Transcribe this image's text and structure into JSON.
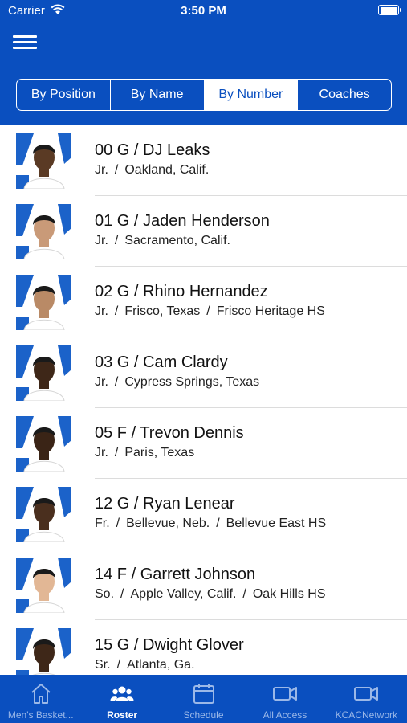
{
  "status_bar": {
    "carrier": "Carrier",
    "time": "3:50 PM"
  },
  "segments": [
    {
      "label": "By Position",
      "active": false
    },
    {
      "label": "By Name",
      "active": false
    },
    {
      "label": "By Number",
      "active": true
    },
    {
      "label": "Coaches",
      "active": false
    }
  ],
  "roster": [
    {
      "title": "00 G / DJ Leaks",
      "details": [
        "Jr.",
        "Oakland, Calif."
      ]
    },
    {
      "title": "01 G / Jaden Henderson",
      "details": [
        "Jr.",
        "Sacramento, Calif."
      ]
    },
    {
      "title": "02 G / Rhino Hernandez",
      "details": [
        "Jr.",
        "Frisco, Texas",
        "Frisco Heritage HS"
      ]
    },
    {
      "title": "03 G / Cam Clardy",
      "details": [
        "Jr.",
        "Cypress Springs, Texas"
      ]
    },
    {
      "title": "05 F / Trevon Dennis",
      "details": [
        "Jr.",
        "Paris, Texas"
      ]
    },
    {
      "title": "12 G / Ryan Lenear",
      "details": [
        "Fr.",
        "Bellevue, Neb.",
        "Bellevue East HS"
      ]
    },
    {
      "title": "14 F / Garrett Johnson",
      "details": [
        "So.",
        "Apple Valley, Calif.",
        "Oak Hills HS"
      ]
    },
    {
      "title": "15 G / Dwight Glover",
      "details": [
        "Sr.",
        "Atlanta, Ga."
      ]
    }
  ],
  "tabs": [
    {
      "label": "Men's Basket...",
      "icon": "home-icon",
      "active": false
    },
    {
      "label": "Roster",
      "icon": "people-icon",
      "active": true
    },
    {
      "label": "Schedule",
      "icon": "calendar-icon",
      "active": false
    },
    {
      "label": "All Access",
      "icon": "video-icon",
      "active": false
    },
    {
      "label": "KCACNetwork",
      "icon": "video-icon",
      "active": false
    }
  ],
  "colors": {
    "brand_blue": "#0a4fbf",
    "inactive_tab": "#9bb8e8"
  }
}
